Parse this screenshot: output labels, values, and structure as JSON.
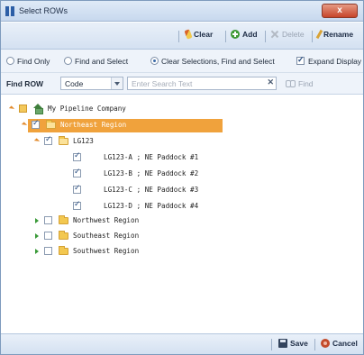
{
  "window": {
    "title": "Select ROWs",
    "close_label": "x"
  },
  "toolbar": {
    "clear_label": "Clear",
    "add_label": "Add",
    "delete_label": "Delete",
    "rename_label": "Rename"
  },
  "options": {
    "find_only": "Find Only",
    "find_and_select": "Find and Select",
    "clear_find_select": "Clear Selections, Find and Select",
    "expand_display": "Expand Display",
    "selected_mode": "Clear Selections, Find and Select",
    "expand_display_checked": true
  },
  "find": {
    "label": "Find ROW",
    "field_value": "Code",
    "search_placeholder": "Enter Search Text",
    "search_value": "",
    "clear_glyph": "✕",
    "find_label": "Find"
  },
  "tree": {
    "root": "My Pipeline Company",
    "region_selected": "Northeast Region",
    "group": "LG123",
    "rows": [
      "LG123-A ; NE Paddock #1",
      "LG123-B ; NE Paddock #2",
      "LG123-C ; NE Paddock #3",
      "LG123-D ; NE Paddock #4"
    ],
    "other_regions": [
      "Northwest Region",
      "Southeast Region",
      "Southwest Region"
    ]
  },
  "footer": {
    "save_label": "Save",
    "cancel_label": "Cancel"
  },
  "colors": {
    "selection": "#f0a23c",
    "titlebar": "#c7d8ee",
    "close": "#c7452a"
  }
}
